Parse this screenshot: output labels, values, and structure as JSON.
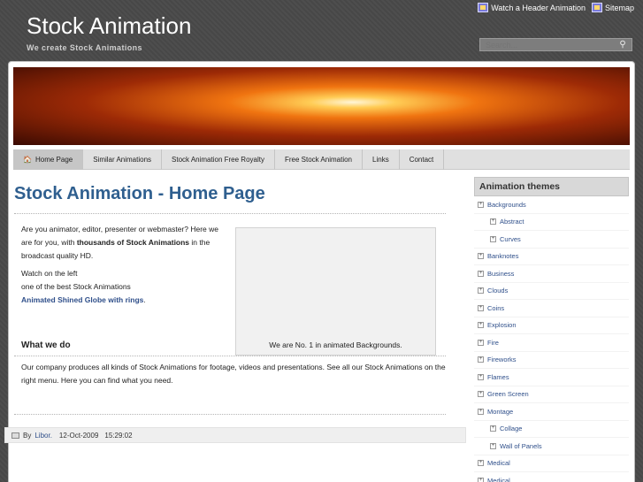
{
  "header": {
    "title": "Stock Animation",
    "tagline": "We create Stock Animations",
    "links": [
      "Watch a Header Animation",
      "Sitemap"
    ],
    "search_placeholder": "Search..."
  },
  "nav": [
    "Home Page",
    "Similar Animations",
    "Stock Animation Free Royalty",
    "Free Stock Animation",
    "Links",
    "Contact"
  ],
  "main": {
    "title": "Stock Animation - Home Page",
    "intro_1a": "Are you animator, editor, presenter or webmaster? Here we are for you, with ",
    "intro_1b": "thousands of Stock Animations",
    "intro_1c": " in the broadcast quality HD.",
    "intro_2": "Watch on the left",
    "intro_3": "one of the best Stock Animations",
    "intro_link": "Animated Shined Globe with rings",
    "intro_link_end": ".",
    "video_caption": "We are No. 1 in animated Backgrounds.",
    "section_heading": "What we do",
    "company": "Our company produces all kinds of Stock Animations for footage, videos and presentations. See all our Stock Animations on the right menu. Here you can find what you need.",
    "byline_prefix": "By",
    "author": "Libor.",
    "date": "12-Oct-2009",
    "time": "15:29:02"
  },
  "sidebar": {
    "heading": "Animation themes",
    "items": [
      {
        "label": "Backgrounds",
        "sub": false
      },
      {
        "label": "Abstract",
        "sub": true
      },
      {
        "label": "Curves",
        "sub": true
      },
      {
        "label": "Banknotes",
        "sub": false
      },
      {
        "label": "Business",
        "sub": false
      },
      {
        "label": "Clouds",
        "sub": false
      },
      {
        "label": "Coins",
        "sub": false
      },
      {
        "label": "Explosion",
        "sub": false
      },
      {
        "label": "Fire",
        "sub": false
      },
      {
        "label": "Fireworks",
        "sub": false
      },
      {
        "label": "Flames",
        "sub": false
      },
      {
        "label": "Green Screen",
        "sub": false
      },
      {
        "label": "Montage",
        "sub": false
      },
      {
        "label": "Collage",
        "sub": true
      },
      {
        "label": "Wall of Panels",
        "sub": true
      },
      {
        "label": "Medical",
        "sub": false
      },
      {
        "label": "Medical",
        "sub": false
      }
    ]
  }
}
